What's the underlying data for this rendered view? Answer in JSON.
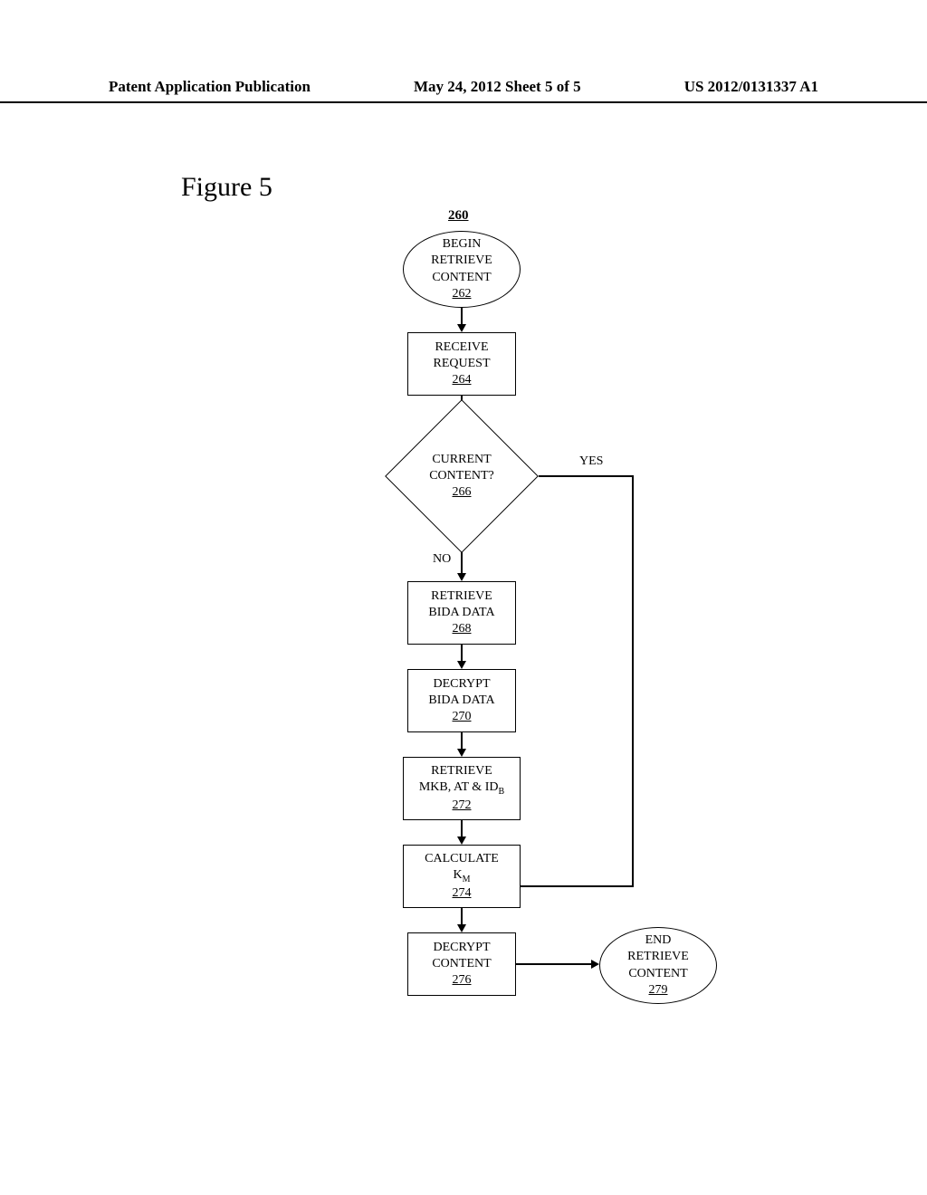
{
  "header": {
    "left": "Patent Application Publication",
    "center": "May 24, 2012  Sheet 5 of 5",
    "right": "US 2012/0131337 A1"
  },
  "figure_title": "Figure 5",
  "chart_data": {
    "type": "flowchart",
    "overall_ref": "260",
    "nodes": [
      {
        "id": "262",
        "type": "terminal",
        "text": "BEGIN RETRIEVE CONTENT",
        "ref": "262"
      },
      {
        "id": "264",
        "type": "process",
        "text": "RECEIVE REQUEST",
        "ref": "264"
      },
      {
        "id": "266",
        "type": "decision",
        "text": "CURRENT CONTENT?",
        "ref": "266",
        "yes_to": "274",
        "no_to": "268"
      },
      {
        "id": "268",
        "type": "process",
        "text": "RETRIEVE BIDA DATA",
        "ref": "268"
      },
      {
        "id": "270",
        "type": "process",
        "text": "DECRYPT BIDA DATA",
        "ref": "270"
      },
      {
        "id": "272",
        "type": "process",
        "text": "RETRIEVE MKB, AT & ID_B",
        "ref": "272"
      },
      {
        "id": "274",
        "type": "process",
        "text": "CALCULATE K_M",
        "ref": "274"
      },
      {
        "id": "276",
        "type": "process",
        "text": "DECRYPT CONTENT",
        "ref": "276"
      },
      {
        "id": "279",
        "type": "terminal",
        "text": "END RETRIEVE CONTENT",
        "ref": "279"
      }
    ],
    "edges": [
      {
        "from": "262",
        "to": "264"
      },
      {
        "from": "264",
        "to": "266"
      },
      {
        "from": "266",
        "to": "268",
        "label": "NO"
      },
      {
        "from": "266",
        "to": "274",
        "label": "YES"
      },
      {
        "from": "268",
        "to": "270"
      },
      {
        "from": "270",
        "to": "272"
      },
      {
        "from": "272",
        "to": "274"
      },
      {
        "from": "274",
        "to": "276"
      },
      {
        "from": "276",
        "to": "279"
      }
    ]
  },
  "labels": {
    "yes": "YES",
    "no": "NO"
  },
  "nodes": {
    "n262_l1": "BEGIN",
    "n262_l2": "RETRIEVE",
    "n262_l3": "CONTENT",
    "n262_ref": "262",
    "n264_l1": "RECEIVE",
    "n264_l2": "REQUEST",
    "n264_ref": "264",
    "n266_l1": "CURRENT",
    "n266_l2": "CONTENT?",
    "n266_ref": "266",
    "n268_l1": "RETRIEVE",
    "n268_l2": "BIDA DATA",
    "n268_ref": "268",
    "n270_l1": "DECRYPT",
    "n270_l2": "BIDA DATA",
    "n270_ref": "270",
    "n272_l1": "RETRIEVE",
    "n272_l2": "MKB, AT & ID",
    "n272_sub": "B",
    "n272_ref": "272",
    "n274_l1": "CALCULATE",
    "n274_l2": "K",
    "n274_sub": "M",
    "n274_ref": "274",
    "n276_l1": "DECRYPT",
    "n276_l2": "CONTENT",
    "n276_ref": "276",
    "n279_l1": "END",
    "n279_l2": "RETRIEVE",
    "n279_l3": "CONTENT",
    "n279_ref": "279",
    "overall_ref": "260"
  }
}
